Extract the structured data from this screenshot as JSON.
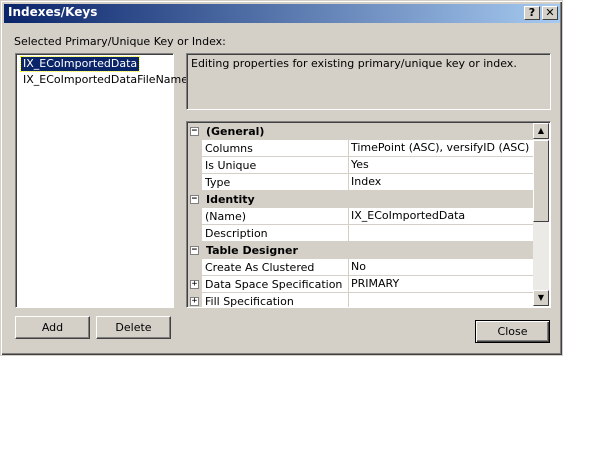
{
  "window": {
    "title": "Indexes/Keys",
    "help_label": "?",
    "close_label": "✕"
  },
  "list": {
    "label": "Selected Primary/Unique Key or Index:",
    "items": [
      "IX_ECoImportedData",
      "IX_ECoImportedDataFileName"
    ],
    "selected_index": 0
  },
  "description": "Editing properties for existing primary/unique key or index.",
  "grid": {
    "rows": [
      {
        "kind": "category",
        "label": "(General)",
        "toggle": "−"
      },
      {
        "kind": "property",
        "name": "Columns",
        "value": "TimePoint (ASC), versifyID (ASC)"
      },
      {
        "kind": "property",
        "name": "Is Unique",
        "value": "Yes"
      },
      {
        "kind": "property",
        "name": "Type",
        "value": "Index"
      },
      {
        "kind": "category",
        "label": "Identity",
        "toggle": "−"
      },
      {
        "kind": "property",
        "name": "(Name)",
        "value": "IX_ECoImportedData"
      },
      {
        "kind": "property",
        "name": "Description",
        "value": ""
      },
      {
        "kind": "category",
        "label": "Table Designer",
        "toggle": "−"
      },
      {
        "kind": "property",
        "name": "Create As Clustered",
        "value": "No"
      },
      {
        "kind": "property",
        "name": "Data Space Specification",
        "value": "PRIMARY",
        "toggle": "+"
      },
      {
        "kind": "property",
        "name": "Fill Specification",
        "value": "",
        "toggle": "+"
      }
    ]
  },
  "buttons": {
    "add": "Add",
    "delete": "Delete",
    "close": "Close"
  },
  "colors": {
    "face": "#d4d0c8",
    "title_start": "#0a246a",
    "title_end": "#a6caf0",
    "selection": "#0a246a"
  }
}
